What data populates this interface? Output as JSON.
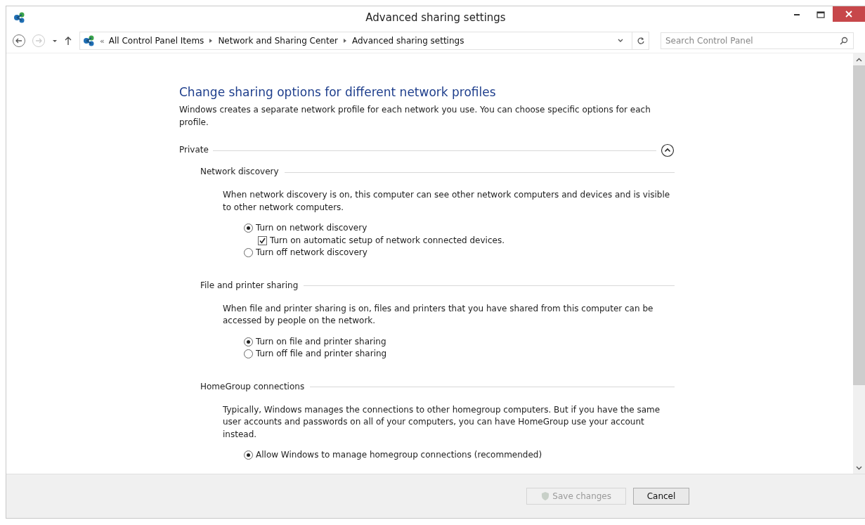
{
  "window": {
    "title": "Advanced sharing settings"
  },
  "navigation": {
    "forward_disabled": true
  },
  "address_bar": {
    "overflow": "«",
    "crumbs": [
      "All Control Panel Items",
      "Network and Sharing Center",
      "Advanced sharing settings"
    ]
  },
  "search": {
    "placeholder": "Search Control Panel"
  },
  "heading": "Change sharing options for different network profiles",
  "intro": "Windows creates a separate network profile for each network you use. You can choose specific options for each profile.",
  "profiles": [
    {
      "name": "Private",
      "expanded": true,
      "sections": [
        {
          "title": "Network discovery",
          "description": "When network discovery is on, this computer can see other network computers and devices and is visible to other network computers.",
          "options": [
            {
              "kind": "radio",
              "label": "Turn on network discovery",
              "selected": true
            },
            {
              "kind": "checkbox",
              "label": "Turn on automatic setup of network connected devices.",
              "checked": true
            },
            {
              "kind": "radio",
              "label": "Turn off network discovery",
              "selected": false
            }
          ]
        },
        {
          "title": "File and printer sharing",
          "description": "When file and printer sharing is on, files and printers that you have shared from this computer can be accessed by people on the network.",
          "options": [
            {
              "kind": "radio",
              "label": "Turn on file and printer sharing",
              "selected": true
            },
            {
              "kind": "radio",
              "label": "Turn off file and printer sharing",
              "selected": false
            }
          ]
        },
        {
          "title": "HomeGroup connections",
          "description": "Typically, Windows manages the connections to other homegroup computers. But if you have the same user accounts and passwords on all of your computers, you can have HomeGroup use your account instead.",
          "options": [
            {
              "kind": "radio",
              "label": "Allow Windows to manage homegroup connections (recommended)",
              "selected": true
            }
          ]
        }
      ]
    }
  ],
  "buttons": [
    {
      "label": "Save changes",
      "disabled": true,
      "shield": true
    },
    {
      "label": "Cancel",
      "disabled": false,
      "shield": false
    }
  ]
}
